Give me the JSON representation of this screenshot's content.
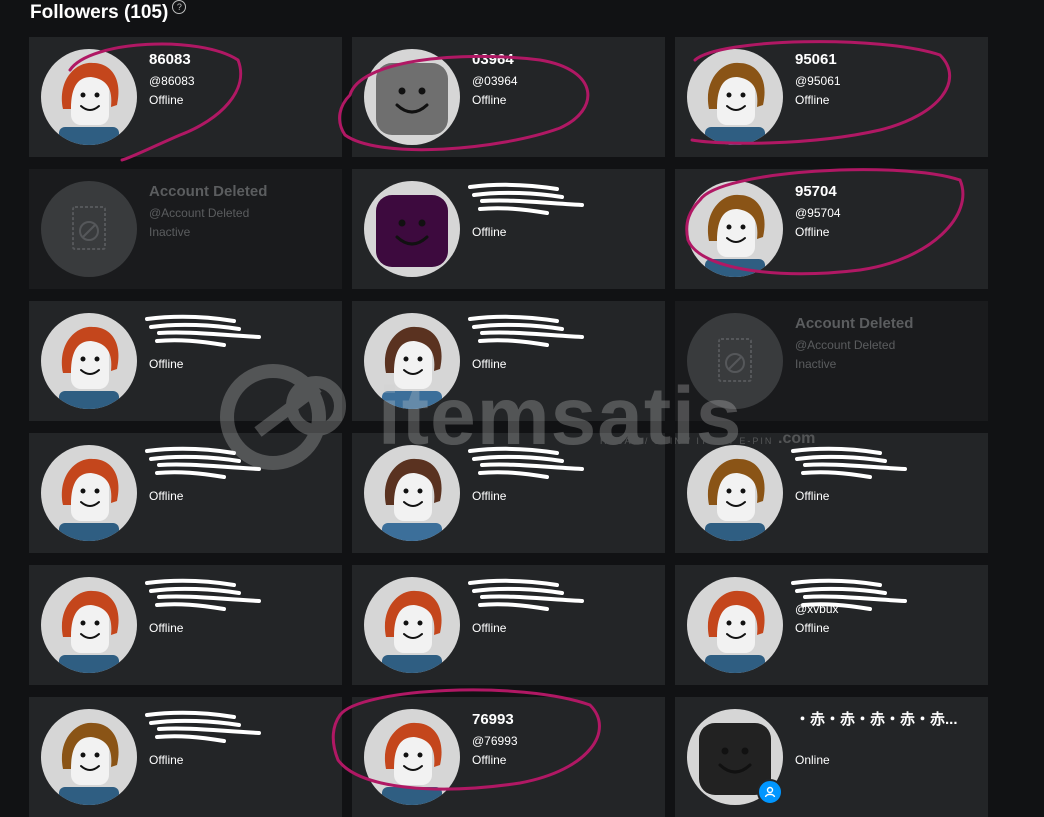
{
  "header": {
    "title": "Followers (105)",
    "help_icon": "question-circle-icon"
  },
  "colors": {
    "background": "#111214",
    "card": "#232527",
    "deleted_card": "#1a1b1d",
    "annotation": "#b01864",
    "online_badge": "#0096ff"
  },
  "followers": [
    {
      "display_name": "86083",
      "username": "@86083",
      "status": "Offline",
      "avatar": "redhair"
    },
    {
      "display_name": "03964",
      "username": "@03964",
      "status": "Offline",
      "avatar": "greybox"
    },
    {
      "display_name": "95061",
      "username": "@95061",
      "status": "Offline",
      "avatar": "brownhair"
    },
    {
      "display_name": "Account Deleted",
      "username": "@Account Deleted",
      "status": "Inactive",
      "avatar": "deleted"
    },
    {
      "display_name": "",
      "username": "",
      "status": "Offline",
      "avatar": "purplebox"
    },
    {
      "display_name": "95704",
      "username": "@95704",
      "status": "Offline",
      "avatar": "brownhair"
    },
    {
      "display_name": "",
      "username": "",
      "status": "Offline",
      "avatar": "redhair"
    },
    {
      "display_name": "",
      "username": "",
      "status": "Offline",
      "avatar": "brownhood"
    },
    {
      "display_name": "Account Deleted",
      "username": "@Account Deleted",
      "status": "Inactive",
      "avatar": "deleted"
    },
    {
      "display_name": "",
      "username": "",
      "status": "Offline",
      "avatar": "redhair"
    },
    {
      "display_name": "",
      "username": "",
      "status": "Offline",
      "avatar": "brownhood"
    },
    {
      "display_name": "",
      "username": "",
      "status": "Offline",
      "avatar": "brownhair"
    },
    {
      "display_name": "",
      "username": "",
      "status": "Offline",
      "avatar": "redhair"
    },
    {
      "display_name": "",
      "username": "",
      "status": "Offline",
      "avatar": "redhair"
    },
    {
      "display_name": "",
      "username": "@xvbux",
      "status": "Offline",
      "avatar": "redhair"
    },
    {
      "display_name": "",
      "username": "",
      "status": "Offline",
      "avatar": "brownhair"
    },
    {
      "display_name": "76993",
      "username": "@76993",
      "status": "Offline",
      "avatar": "redhair"
    },
    {
      "display_name": "・赤・赤・赤・赤・赤...",
      "username": "",
      "status": "Online",
      "avatar": "blackbox",
      "online_icon": "person-icon"
    }
  ],
  "watermark": {
    "word": "itemsatis",
    "tagline": "HESAP / SKIN / ITEM / E-PIN",
    "suffix": ".com"
  }
}
